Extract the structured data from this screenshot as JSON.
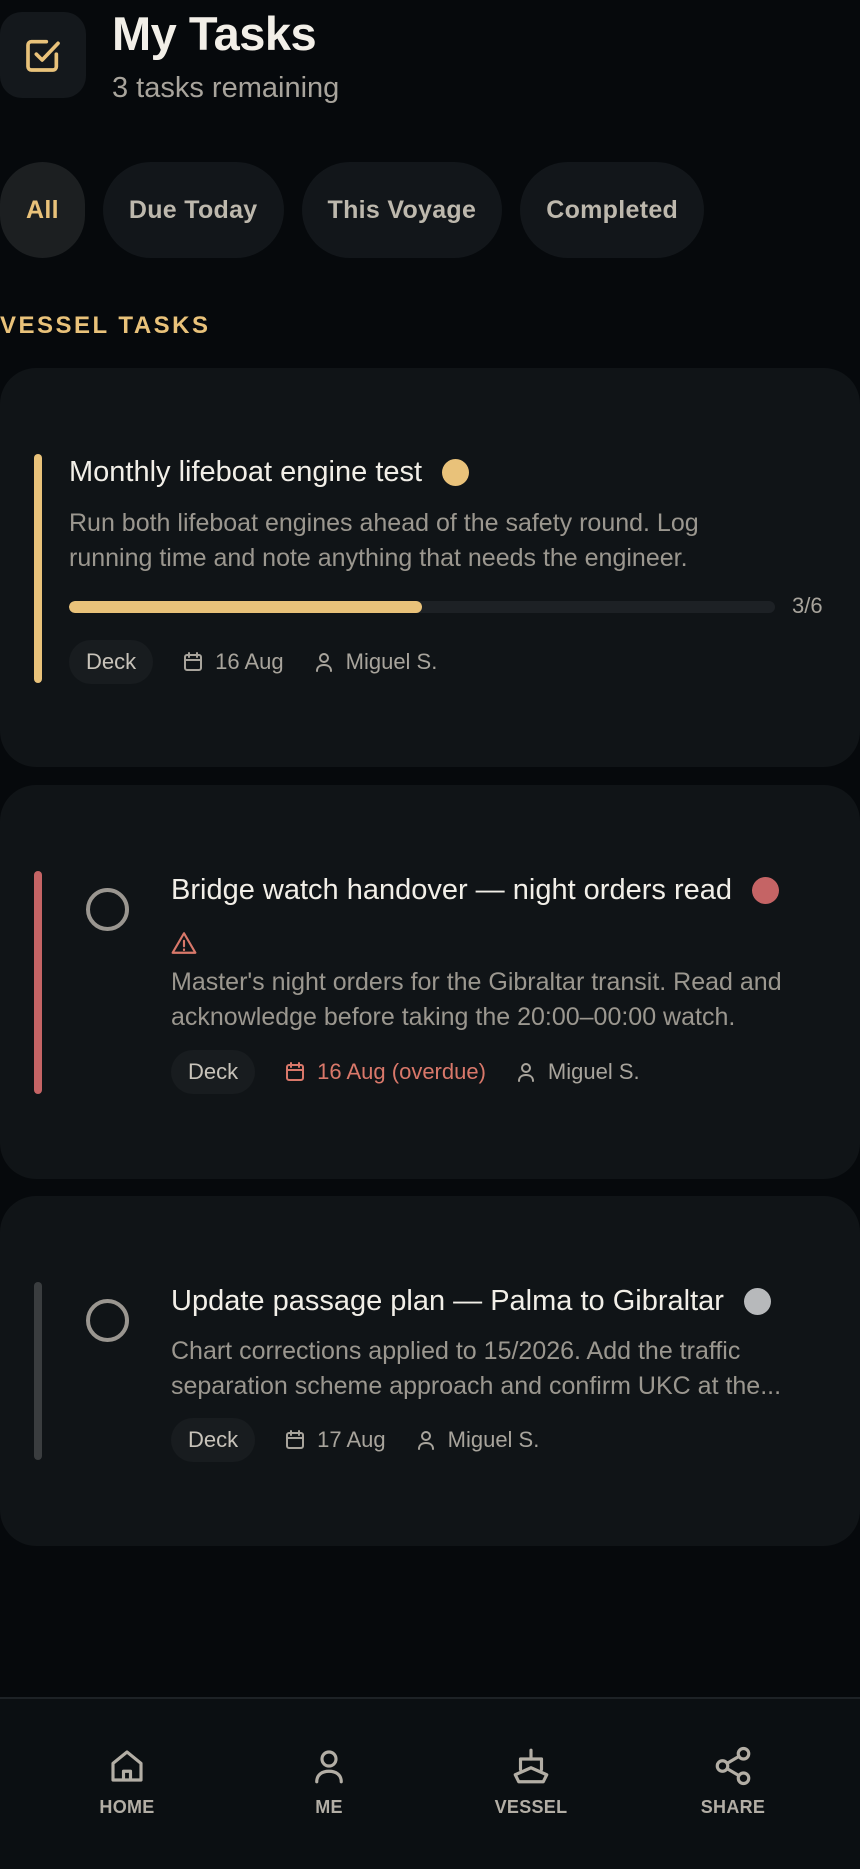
{
  "header": {
    "title": "My Tasks",
    "subtitle": "3 tasks remaining",
    "icon": "checkbox-icon"
  },
  "filters": [
    {
      "label": "All",
      "active": true
    },
    {
      "label": "Due Today",
      "active": false
    },
    {
      "label": "This Voyage",
      "active": false
    },
    {
      "label": "Completed",
      "active": false
    }
  ],
  "section": {
    "label": "VESSEL TASKS"
  },
  "tasks": [
    {
      "title": "Monthly lifeboat engine test",
      "description_line1": "Run both lifeboat engines ahead of the safety round. Log",
      "description_line2": "running time and note anything that needs the engineer.",
      "progress": {
        "done": 3,
        "total": 6,
        "label": "3/6"
      },
      "tag": "Deck",
      "due": "16 Aug",
      "assignee": "Miguel S.",
      "accent_color": "#e9c27a",
      "status_color": "#e9c27a"
    },
    {
      "title": "Bridge watch handover — night orders read",
      "description_line1": "Master's night orders for the Gibraltar transit. Read and",
      "description_line2": "acknowledge before taking the 20:00–00:00 watch.",
      "tag": "Deck",
      "due": "16 Aug (overdue)",
      "assignee": "Miguel S.",
      "accent_color": "#c56465",
      "status_color": "#c56465",
      "warning_icon": "warning-icon"
    },
    {
      "title": "Update passage plan — Palma to Gibraltar",
      "description_line1": "Chart corrections applied to 15/2026. Add the traffic",
      "description_line2": "separation scheme approach and confirm UKC at the...",
      "tag": "Deck",
      "due": "17 Aug",
      "assignee": "Miguel S.",
      "accent_color": "#3a3d3f",
      "status_color": "#b7b9bb"
    }
  ],
  "nav": [
    {
      "label": "HOME",
      "icon": "home-icon"
    },
    {
      "label": "ME",
      "icon": "user-icon"
    },
    {
      "label": "VESSEL",
      "icon": "ship-icon"
    },
    {
      "label": "SHARE",
      "icon": "share-icon"
    }
  ]
}
